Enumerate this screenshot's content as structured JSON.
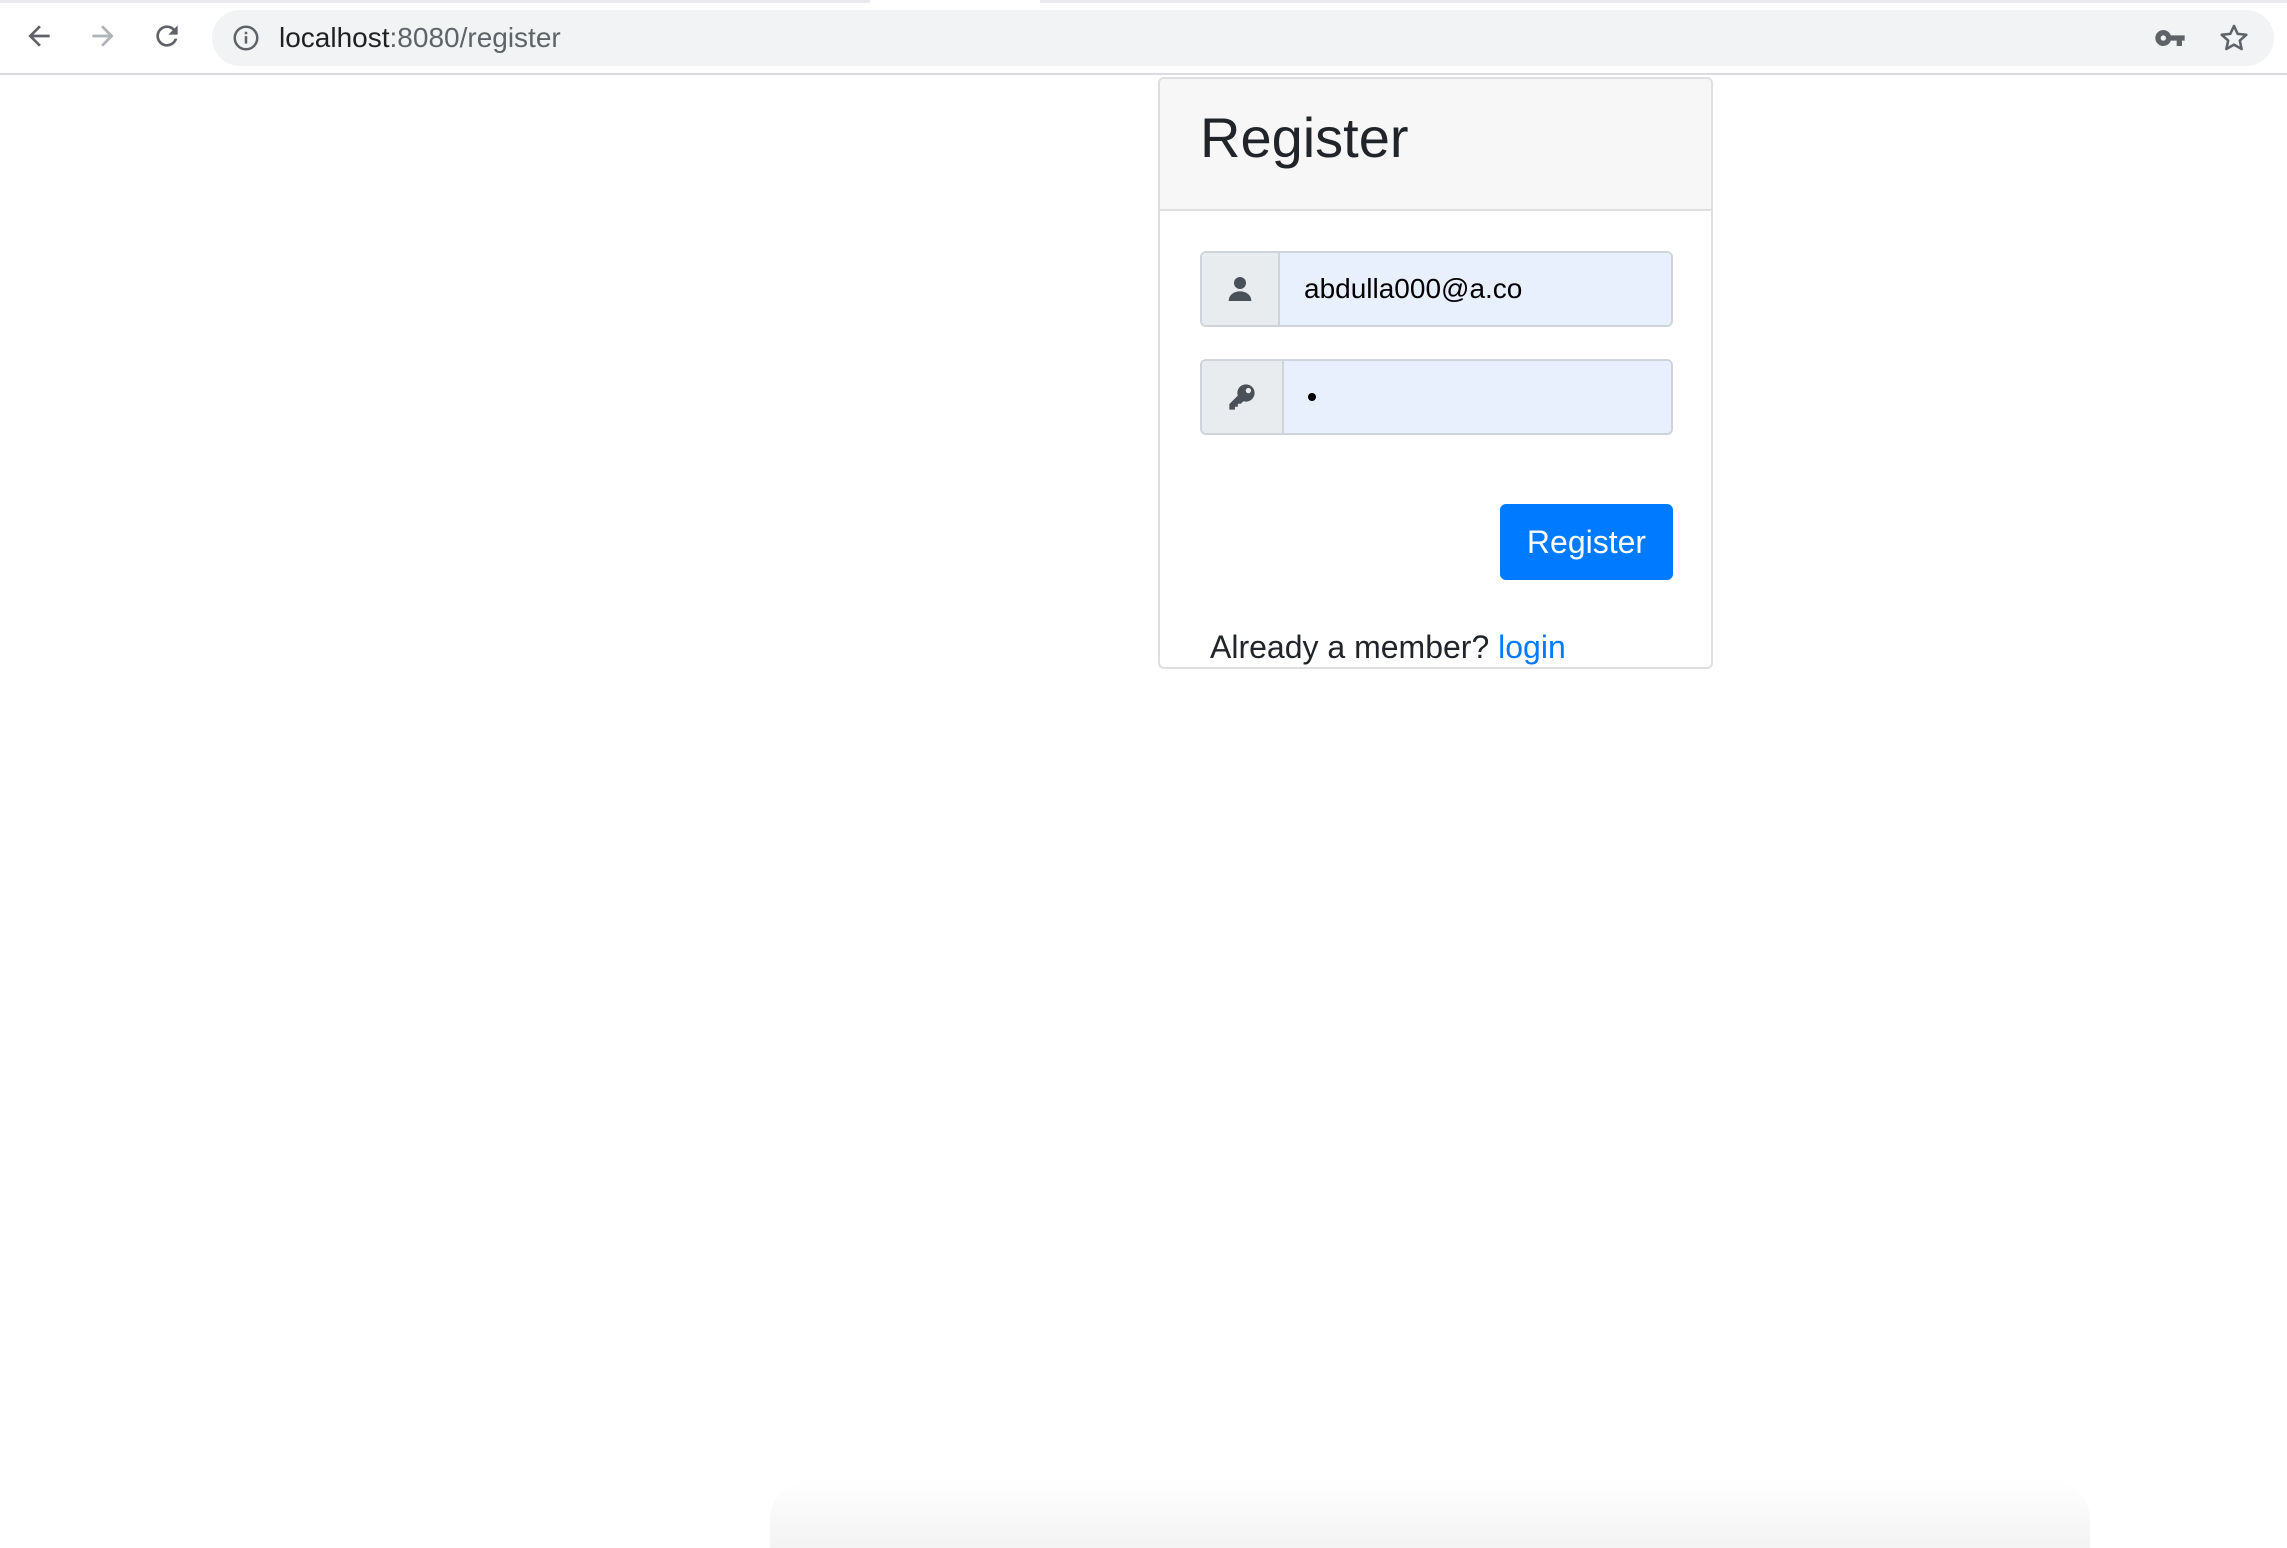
{
  "browser": {
    "url_host": "localhost",
    "url_path": ":8080/register",
    "icons": [
      "back-arrow-icon",
      "forward-arrow-icon",
      "reload-icon",
      "info-icon",
      "key-icon",
      "star-icon"
    ]
  },
  "card": {
    "title": "Register",
    "email_value": "abdulla000@a.co",
    "password_masked": "•",
    "register_button": "Register",
    "member_prompt": "Already a member? ",
    "login_link": "login"
  },
  "colors": {
    "primary": "#007bff",
    "autofill_bg": "#e8f0fe",
    "addon_bg": "#e9ecef",
    "card_header_bg": "#f7f7f7"
  }
}
